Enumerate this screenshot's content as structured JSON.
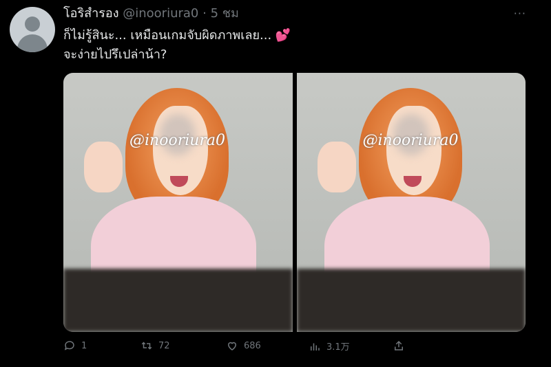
{
  "tweet": {
    "name": "โอริสำรอง",
    "handle": "@inooriura0",
    "time": "· 5 ชม",
    "more": "···",
    "text_line1": "ก็ไม่รู้สินะ... เหมือนเกมจับผิดภาพเลย...",
    "emoji": "💕",
    "text_line2": "จะง่ายไปรึเปล่าน้า?"
  },
  "media": {
    "watermark": "@inooriura0"
  },
  "actions": {
    "reply_count": "1",
    "retweet_count": "72",
    "like_count": "686",
    "views_count": "3.1万"
  }
}
